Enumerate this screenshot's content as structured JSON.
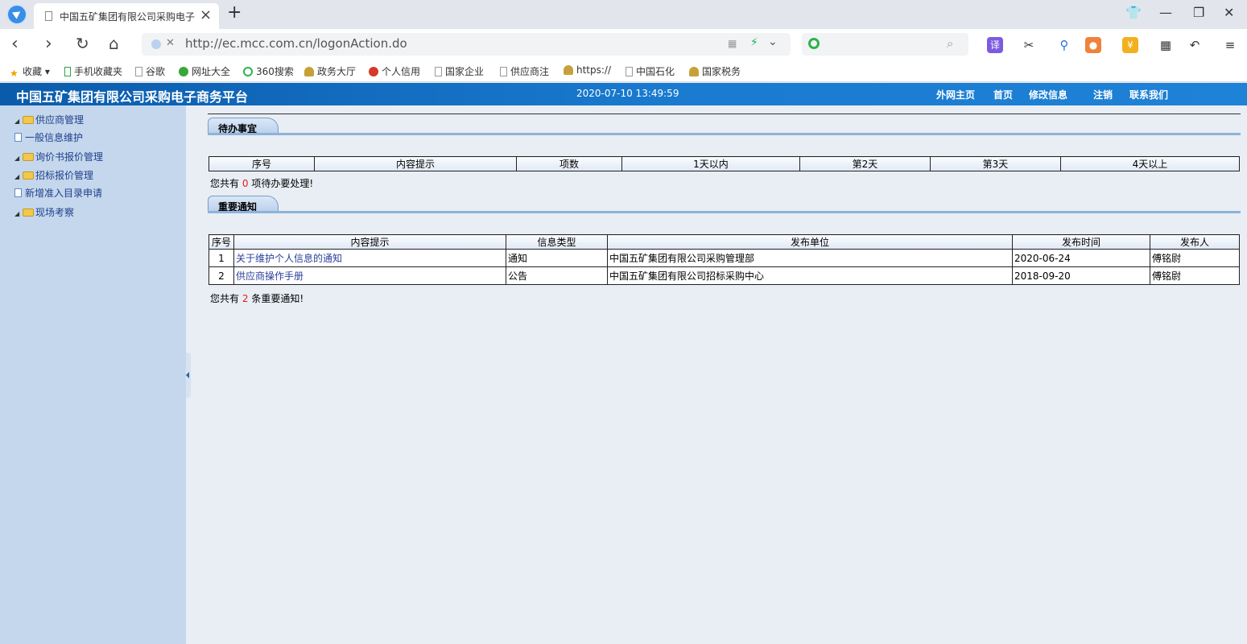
{
  "browser": {
    "tab_title": "中国五矿集团有限公司采购电子",
    "url": "http://ec.mcc.com.cn/logonAction.do",
    "new_tab": "+",
    "translate_label": "译"
  },
  "bookmarks": [
    "收藏",
    "手机收藏夹",
    "谷歌",
    "网址大全",
    "360搜索",
    "政务大厅",
    "个人信用",
    "国家企业",
    "供应商注",
    "https://",
    "中国石化",
    "国家税务"
  ],
  "site": {
    "title": "中国五矿集团有限公司采购电子商务平台",
    "datetime": "2020-07-10 13:49:59",
    "nav": [
      "外网主页",
      "首页",
      "修改信息",
      "注销",
      "联系我们"
    ]
  },
  "sidebar": {
    "items": [
      {
        "label": "供应商管理",
        "type": "folder"
      },
      {
        "label": "一般信息维护",
        "type": "doc"
      },
      {
        "label": "询价书报价管理",
        "type": "folder"
      },
      {
        "label": "招标报价管理",
        "type": "folder"
      },
      {
        "label": "新增准入目录申请",
        "type": "doc"
      },
      {
        "label": "现场考察",
        "type": "folder"
      }
    ]
  },
  "todo": {
    "title": "待办事宜",
    "columns": [
      "序号",
      "内容提示",
      "项数",
      "1天以内",
      "第2天",
      "第3天",
      "4天以上"
    ],
    "summary_prefix": "您共有",
    "count": "0",
    "summary_suffix": "项待办要处理!"
  },
  "notices": {
    "title": "重要通知",
    "columns": [
      "序号",
      "内容提示",
      "信息类型",
      "发布单位",
      "发布时间",
      "发布人"
    ],
    "rows": [
      {
        "no": "1",
        "content": "关于维护个人信息的通知",
        "type": "通知",
        "unit": "中国五矿集团有限公司采购管理部",
        "date": "2020-06-24",
        "publisher": "傅铭尉"
      },
      {
        "no": "2",
        "content": "供应商操作手册",
        "type": "公告",
        "unit": "中国五矿集团有限公司招标采购中心",
        "date": "2018-09-20",
        "publisher": "傅铭尉"
      }
    ],
    "summary_prefix": "您共有",
    "count": "2",
    "summary_suffix": "条重要通知!"
  }
}
